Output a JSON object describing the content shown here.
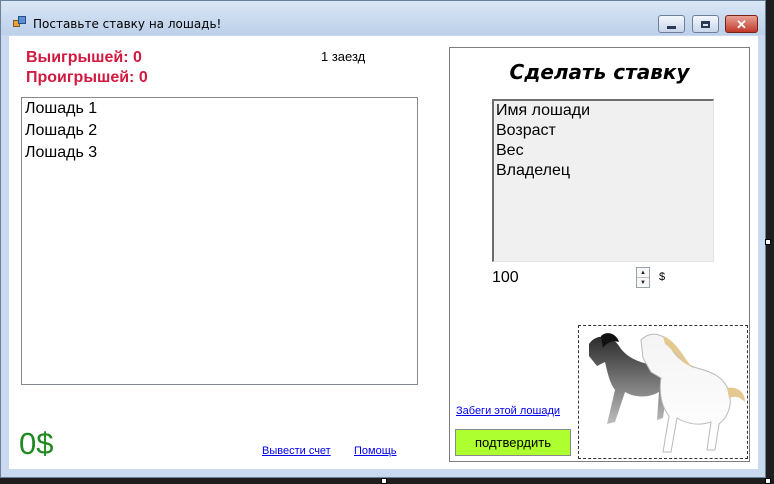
{
  "window": {
    "title": "Поставьте ставку на лошадь!",
    "icon": "app-icon"
  },
  "stats": {
    "wins": "Выигрышей: 0",
    "losses": "Проигрышей: 0",
    "race": "1 заезд"
  },
  "horses": [
    "Лошадь 1",
    "Лошадь 2",
    "Лошадь 3"
  ],
  "balance": "0$",
  "links": {
    "withdraw": "Вывести счет",
    "help": "Помощь",
    "races": "Забеги этой лошади"
  },
  "bet": {
    "title": "Сделать ставку",
    "info": [
      "Имя лошади",
      "Возраст",
      "Вес",
      "Владелец"
    ],
    "amount": "100",
    "currency": "$",
    "confirm": "подтвердить"
  },
  "colors": {
    "accent_red": "#d11a3f",
    "balance_green": "#1f8a1f",
    "confirm_bg": "#adff2f",
    "link": "#0000ee"
  }
}
